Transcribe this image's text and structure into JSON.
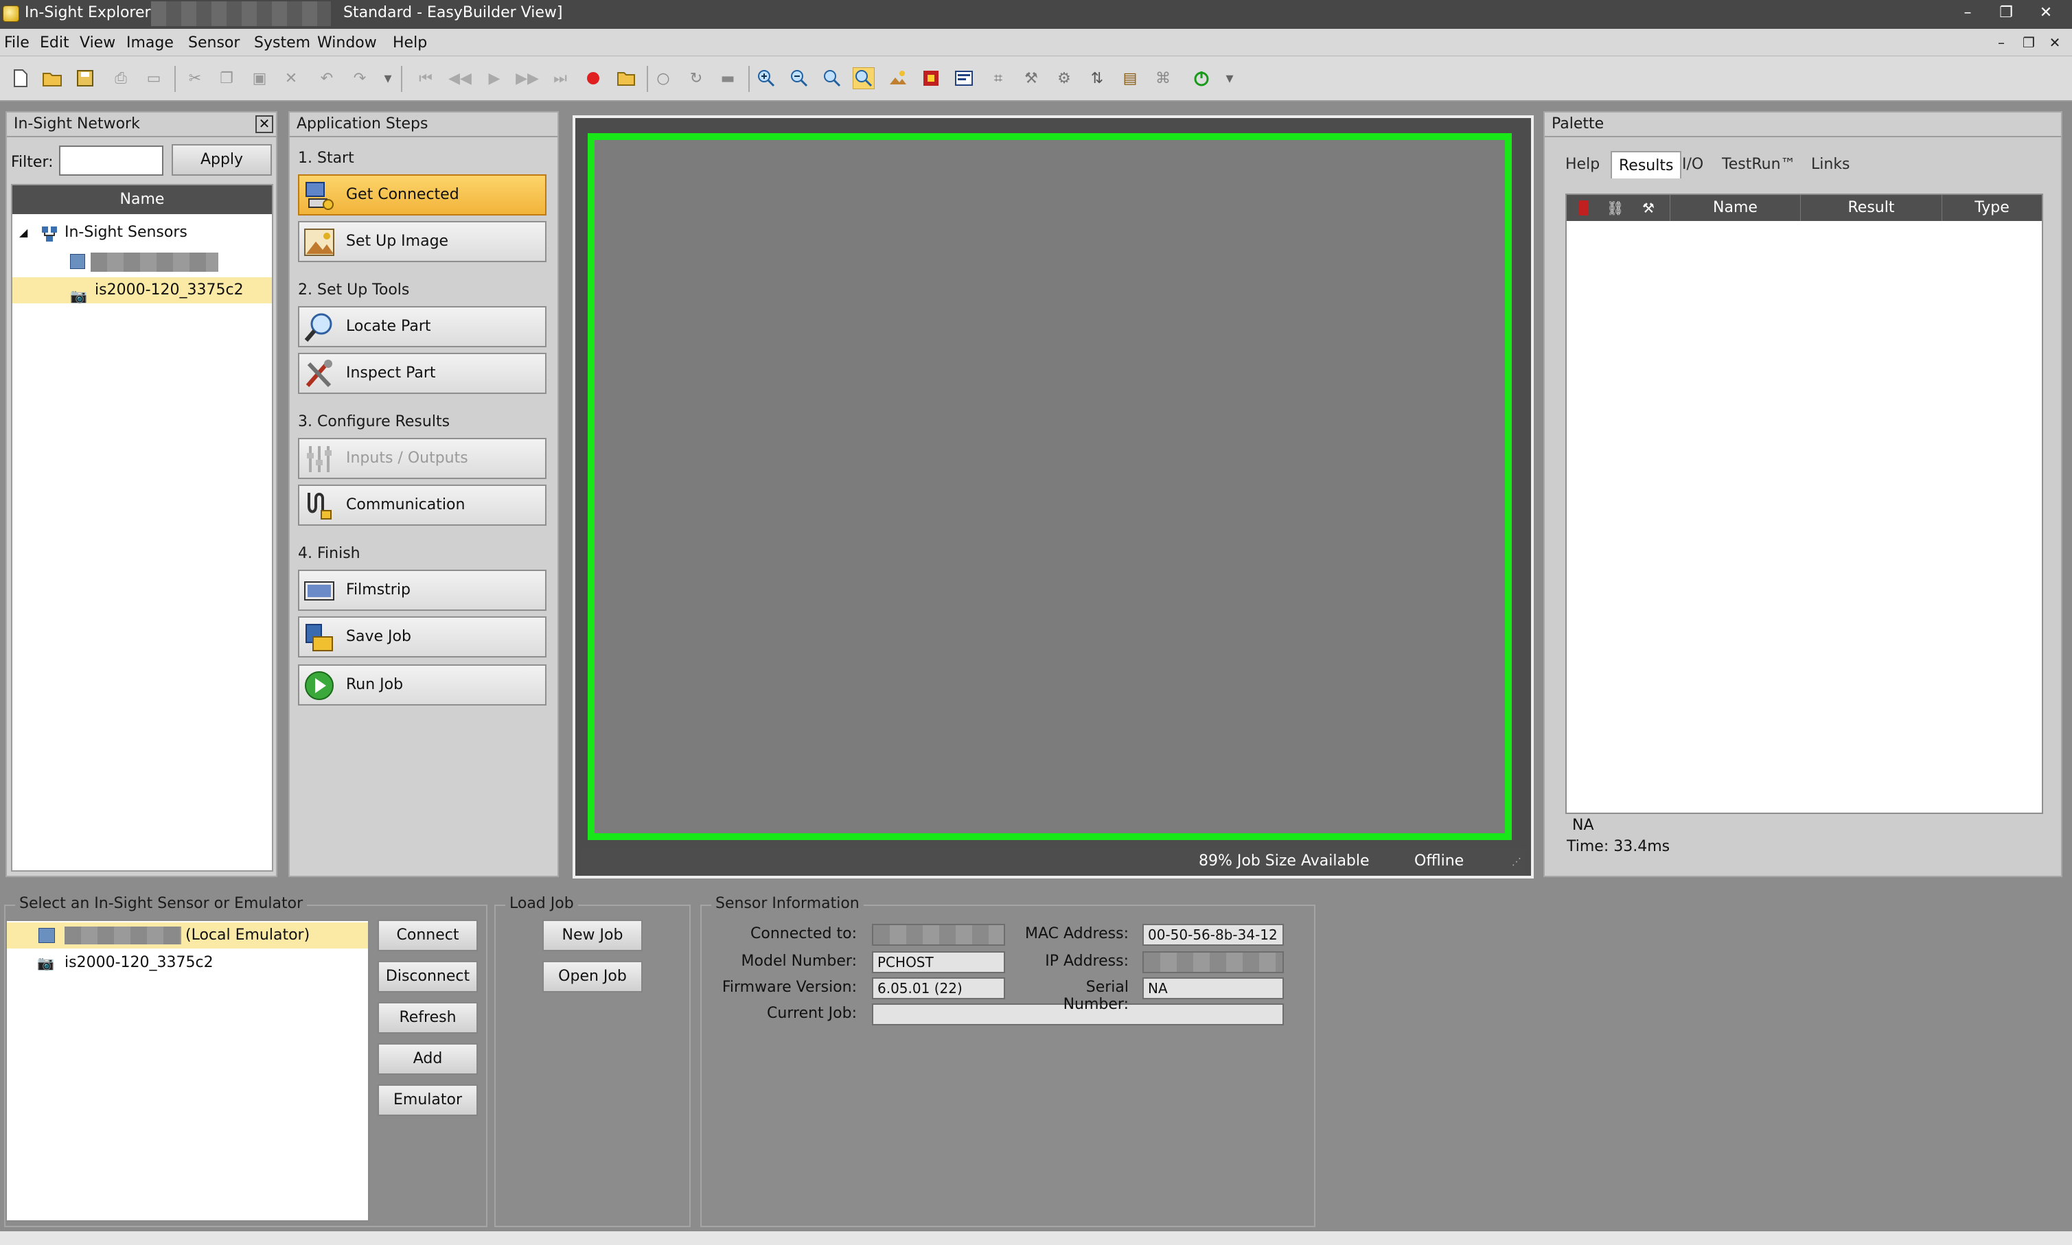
{
  "titlebar": {
    "app_name": "In-Sight Explorer -",
    "view_name": "Standard - EasyBuilder View]",
    "controls": [
      "–",
      "❐",
      "✕"
    ]
  },
  "menu": {
    "items": [
      "File",
      "Edit",
      "View",
      "Image",
      "Sensor",
      "System",
      "Window",
      "Help"
    ],
    "mdi_controls": [
      "–",
      "❐",
      "✕"
    ]
  },
  "toolbar": {
    "icons": [
      "new-icon",
      "open-icon",
      "save-icon",
      "print-icon",
      "print-preview-icon",
      "cut-icon",
      "copy-icon",
      "paste-icon",
      "delete-icon",
      "undo-icon",
      "redo-icon",
      "first-icon",
      "previous-icon",
      "play-icon",
      "next-icon",
      "last-icon",
      "record-icon",
      "folder-icon",
      "trigger-icon",
      "repeat-icon",
      "camera-icon",
      "zoom-in-icon",
      "zoom-out-icon",
      "zoom-fit-icon",
      "zoom-active-icon",
      "image-icon",
      "color-icon",
      "display-icon",
      "calibrate-icon",
      "tools-icon",
      "settings-icon",
      "fileio-icon",
      "job-icon",
      "network-icon",
      "online-icon"
    ]
  },
  "network": {
    "title": "In-Sight Network",
    "filter_label": "Filter:",
    "filter_value": "",
    "apply_label": "Apply",
    "column_name": "Name",
    "root_label": "In-Sight Sensors",
    "sensor_label": "is2000-120_3375c2"
  },
  "steps": {
    "title": "Application Steps",
    "groups": [
      {
        "title": "1. Start",
        "buttons": [
          "Get Connected",
          "Set Up Image"
        ]
      },
      {
        "title": "2. Set Up Tools",
        "buttons": [
          "Locate Part",
          "Inspect Part"
        ]
      },
      {
        "title": "3. Configure Results",
        "buttons": [
          "Inputs / Outputs",
          "Communication"
        ]
      },
      {
        "title": "4. Finish",
        "buttons": [
          "Filmstrip",
          "Save Job",
          "Run Job"
        ]
      }
    ]
  },
  "image_view": {
    "job_size": "89% Job Size Available",
    "status": "Offline"
  },
  "palette": {
    "title": "Palette",
    "tabs": [
      "Help",
      "Results",
      "I/O",
      "TestRun™",
      "Links"
    ],
    "active_tab": "Results",
    "columns": [
      "Name",
      "Result",
      "Type"
    ],
    "footer_value": "NA",
    "footer_time": "Time: 33.4ms"
  },
  "select_sensor": {
    "legend": "Select an In-Sight Sensor or Emulator",
    "items": [
      "(Local Emulator)",
      "is2000-120_3375c2"
    ],
    "buttons": [
      "Connect",
      "Disconnect",
      "Refresh",
      "Add",
      "Emulator"
    ]
  },
  "load_job": {
    "legend": "Load Job",
    "buttons": [
      "New Job",
      "Open Job"
    ]
  },
  "sensor_info": {
    "legend": "Sensor Information",
    "connected_to_label": "Connected to:",
    "model_label": "Model Number:",
    "model_value": "PCHOST",
    "firmware_label": "Firmware Version:",
    "firmware_value": "6.05.01 (22)",
    "current_job_label": "Current Job:",
    "current_job_value": "",
    "mac_label": "MAC Address:",
    "mac_value": "00-50-56-8b-34-12",
    "ip_label": "IP Address:",
    "serial_label": "Serial Number:",
    "serial_value": "NA"
  },
  "colors": {
    "highlight": "#f2b43a",
    "canvas_border": "#18e818",
    "selection": "#fbe9a6"
  }
}
